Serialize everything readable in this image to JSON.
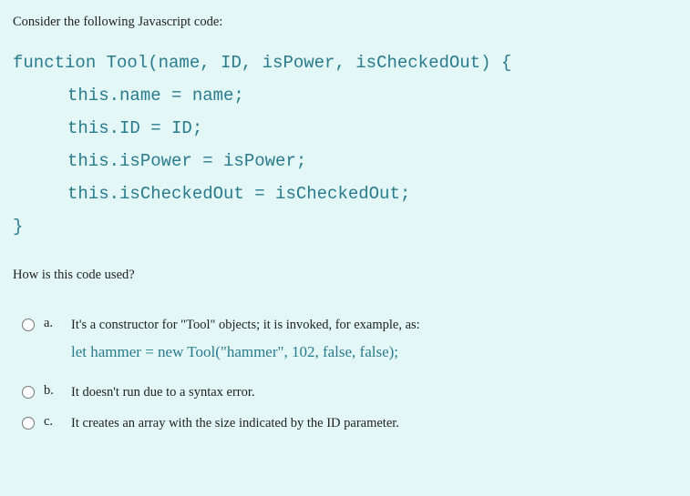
{
  "prompt": "Consider the following Javascript code:",
  "code": {
    "line1": "function Tool(name, ID, isPower, isCheckedOut) {",
    "line2": "this.name = name;",
    "line3": "this.ID = ID;",
    "line4": "this.isPower = isPower;",
    "line5": "this.isCheckedOut = isCheckedOut;",
    "line6": "}"
  },
  "question": "How is this code used?",
  "options": [
    {
      "letter": "a.",
      "text": "It's a constructor for \"Tool\" objects; it is invoked, for example, as:",
      "code": "let hammer = new Tool(\"hammer\", 102, false, false);"
    },
    {
      "letter": "b.",
      "text": "It doesn't run due to a syntax error."
    },
    {
      "letter": "c.",
      "text": "It creates an array with the size indicated by the ID parameter."
    }
  ]
}
